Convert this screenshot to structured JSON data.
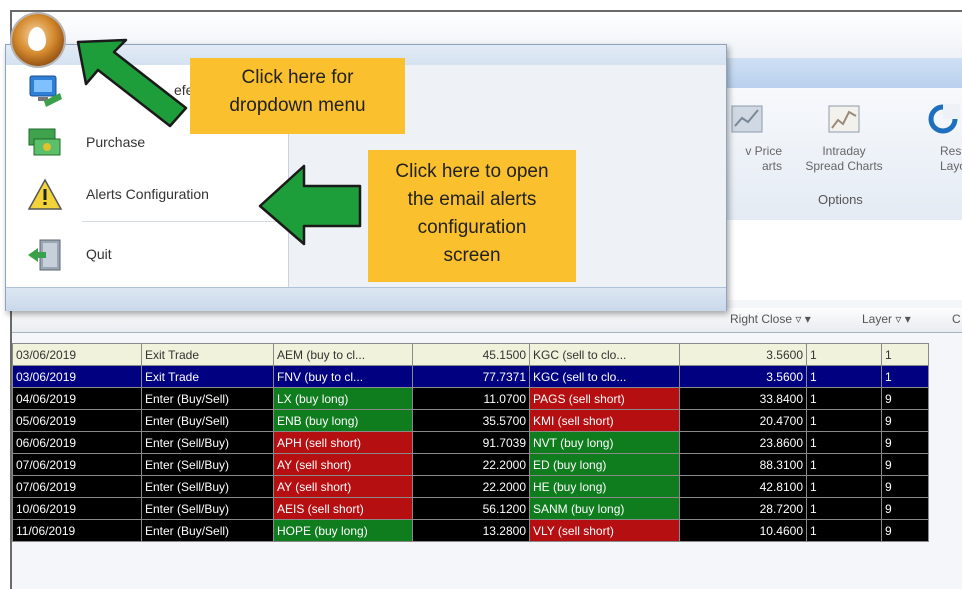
{
  "ribbon": {
    "buttons": [
      {
        "label_line1": "v Price",
        "label_line2": "arts",
        "icon": "price-chart-icon"
      },
      {
        "label_line1": "Intraday",
        "label_line2": "Spread Charts",
        "icon": "spread-chart-icon"
      },
      {
        "label_line1": "Res",
        "label_line2": "Layo",
        "icon": "reset-layout-icon"
      }
    ],
    "group_label": "Options"
  },
  "app_menu": {
    "items": [
      {
        "label": "efe",
        "icon": "preferences-icon"
      },
      {
        "label": "Purchase",
        "icon": "purchase-icon"
      },
      {
        "label": "Alerts Configuration",
        "icon": "warning-icon"
      },
      {
        "label": "Quit",
        "icon": "exit-door-icon"
      }
    ]
  },
  "callouts": {
    "dropdown": {
      "line1": "Click here for",
      "line2": "dropdown menu"
    },
    "alerts": {
      "line1": "Click here to open",
      "line2": "the email alerts",
      "line3": "configuration",
      "line4": "screen"
    }
  },
  "grid": {
    "columns": {
      "right_close": "Right Close",
      "layer": "Layer",
      "extra": "C"
    },
    "rows": [
      {
        "date": "03/06/2019",
        "type": "Exit Trade",
        "left_symbol": "AEM  (buy to cl...",
        "left_close": "45.1500",
        "right_symbol": "KGC  (sell to clo...",
        "right_close": "3.5600",
        "layer": "1",
        "extra": "1",
        "style": "light",
        "left_kind": "",
        "right_kind": ""
      },
      {
        "date": "03/06/2019",
        "type": "Exit Trade",
        "left_symbol": "FNV  (buy to cl...",
        "left_close": "77.7371",
        "right_symbol": "KGC  (sell to clo...",
        "right_close": "3.5600",
        "layer": "1",
        "extra": "1",
        "style": "selected",
        "left_kind": "",
        "right_kind": ""
      },
      {
        "date": "04/06/2019",
        "type": "Enter (Buy/Sell)",
        "left_symbol": "LX  (buy long)",
        "left_close": "11.0700",
        "right_symbol": "PAGS  (sell short)",
        "right_close": "33.8400",
        "layer": "1",
        "extra": "9",
        "style": "dark",
        "left_kind": "buy",
        "right_kind": "sell"
      },
      {
        "date": "05/06/2019",
        "type": "Enter (Buy/Sell)",
        "left_symbol": "ENB  (buy long)",
        "left_close": "35.5700",
        "right_symbol": "KMI  (sell short)",
        "right_close": "20.4700",
        "layer": "1",
        "extra": "9",
        "style": "dark",
        "left_kind": "buy",
        "right_kind": "sell"
      },
      {
        "date": "06/06/2019",
        "type": "Enter (Sell/Buy)",
        "left_symbol": "APH  (sell short)",
        "left_close": "91.7039",
        "right_symbol": "NVT  (buy long)",
        "right_close": "23.8600",
        "layer": "1",
        "extra": "9",
        "style": "dark",
        "left_kind": "sell",
        "right_kind": "buy"
      },
      {
        "date": "07/06/2019",
        "type": "Enter (Sell/Buy)",
        "left_symbol": "AY  (sell short)",
        "left_close": "22.2000",
        "right_symbol": "ED  (buy long)",
        "right_close": "88.3100",
        "layer": "1",
        "extra": "9",
        "style": "dark",
        "left_kind": "sell",
        "right_kind": "buy"
      },
      {
        "date": "07/06/2019",
        "type": "Enter (Sell/Buy)",
        "left_symbol": "AY  (sell short)",
        "left_close": "22.2000",
        "right_symbol": "HE  (buy long)",
        "right_close": "42.8100",
        "layer": "1",
        "extra": "9",
        "style": "dark",
        "left_kind": "sell",
        "right_kind": "buy"
      },
      {
        "date": "10/06/2019",
        "type": "Enter (Sell/Buy)",
        "left_symbol": "AEIS  (sell short)",
        "left_close": "56.1200",
        "right_symbol": "SANM  (buy long)",
        "right_close": "28.7200",
        "layer": "1",
        "extra": "9",
        "style": "dark",
        "left_kind": "sell",
        "right_kind": "buy"
      },
      {
        "date": "11/06/2019",
        "type": "Enter (Buy/Sell)",
        "left_symbol": "HOPE  (buy long)",
        "left_close": "13.2800",
        "right_symbol": "VLY  (sell short)",
        "right_close": "10.4600",
        "layer": "1",
        "extra": "9",
        "style": "dark",
        "left_kind": "buy",
        "right_kind": "sell"
      }
    ]
  },
  "colors": {
    "buy": "#0f7d1e",
    "sell": "#b50f12",
    "selected_row": "#000080",
    "callout": "#fbc02d",
    "arrow": "#1e9e3a"
  }
}
